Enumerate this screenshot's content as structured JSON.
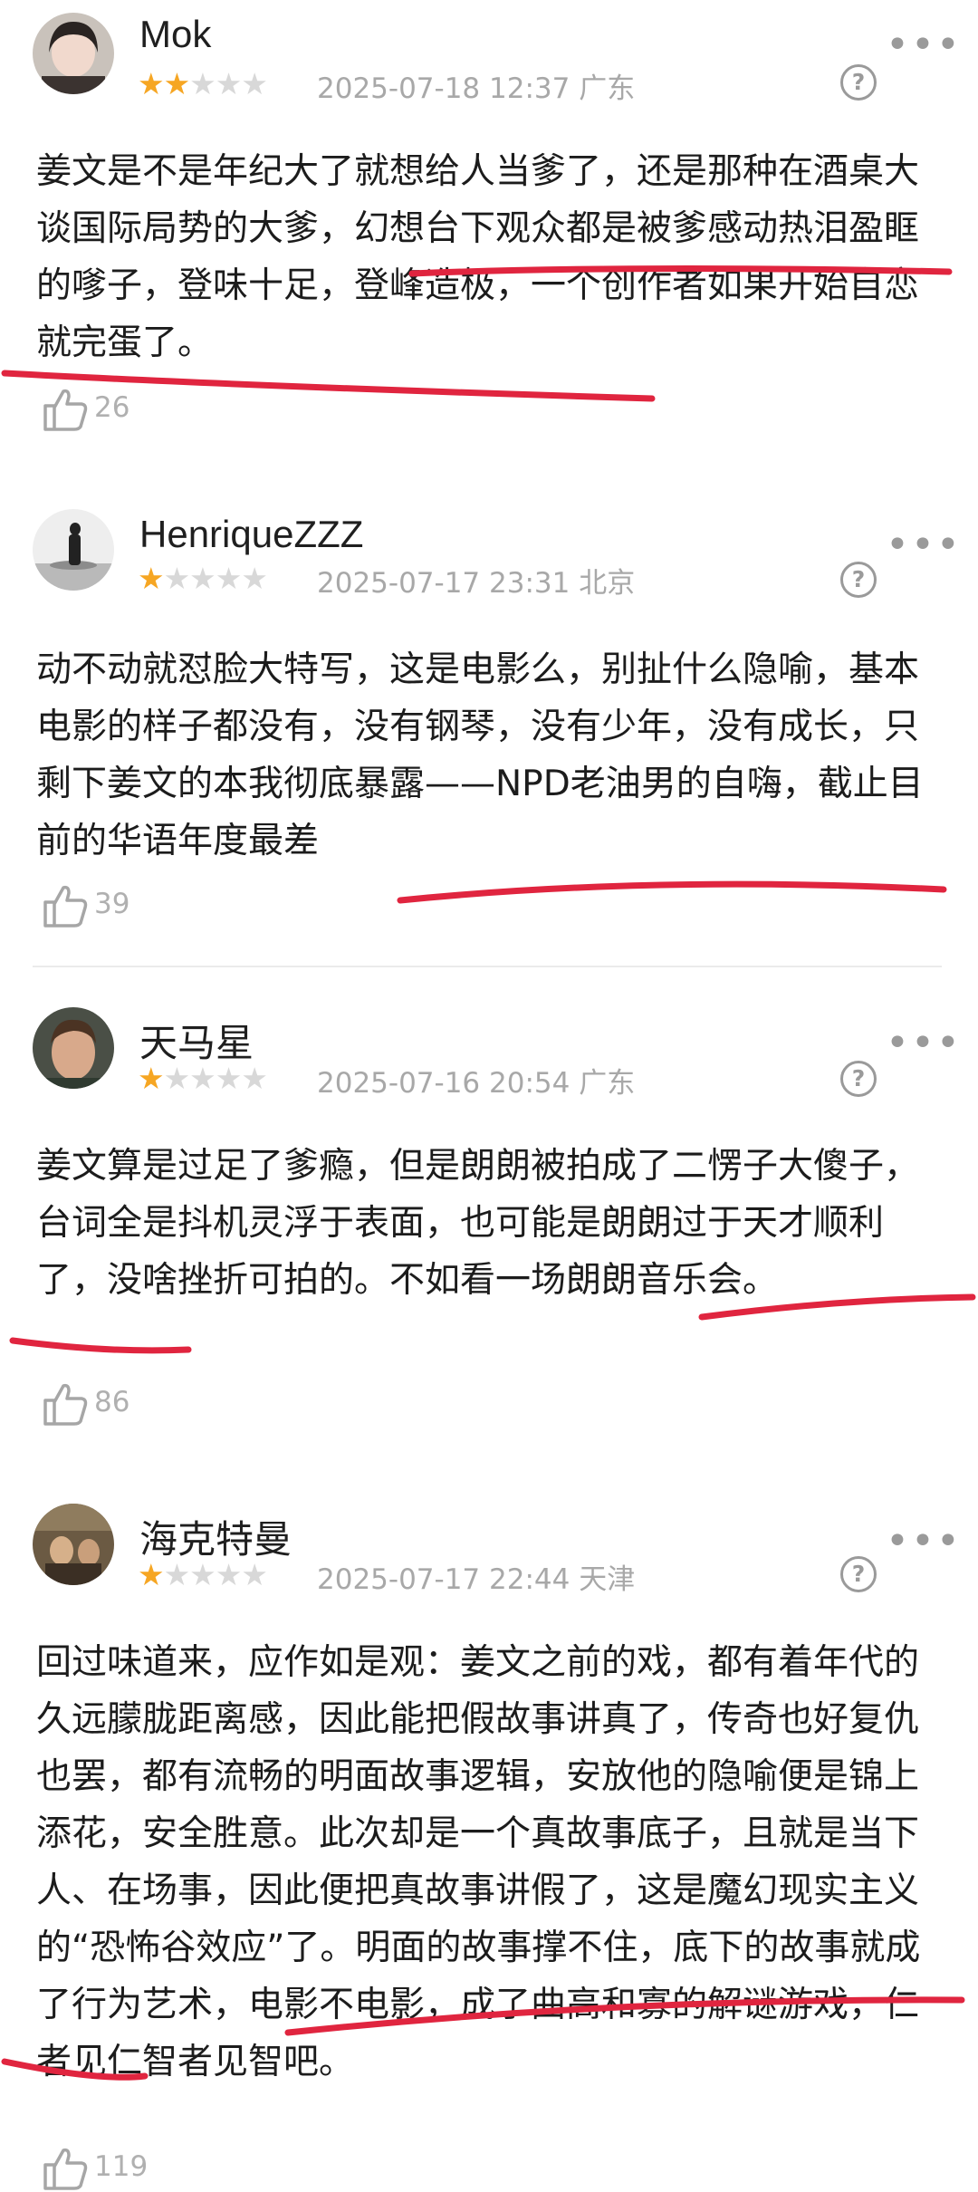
{
  "reviews": [
    {
      "username": "Mok",
      "rating": 2,
      "date": "2025-07-18 12:37",
      "location": "广东",
      "text": "姜文是不是年纪大了就想给人当爹了，还是那种在酒桌大谈国际局势的大爹，幻想台下观众都是被爹感动热泪盈眶的嗲子，登味十足，登峰造极，一个创作者如果开始自恋就完蛋了。",
      "likes": "26"
    },
    {
      "username": "HenriqueZZZ",
      "rating": 1,
      "date": "2025-07-17 23:31",
      "location": "北京",
      "text": "动不动就怼脸大特写，这是电影么，别扯什么隐喻，基本电影的样子都没有，没有钢琴，没有少年，没有成长，只剩下姜文的本我彻底暴露——NPD老油男的自嗨，截止目前的华语年度最差",
      "likes": "39"
    },
    {
      "username": "天马星",
      "rating": 1,
      "date": "2025-07-16 20:54",
      "location": "广东",
      "text": "姜文算是过足了爹瘾，但是朗朗被拍成了二愣子大傻子，台词全是抖机灵浮于表面，也可能是朗朗过于天才顺利了，没啥挫折可拍的。不如看一场朗朗音乐会。",
      "likes": "86"
    },
    {
      "username": "海克特曼",
      "rating": 1,
      "date": "2025-07-17 22:44",
      "location": "天津",
      "text": "回过味道来，应作如是观：姜文之前的戏，都有着年代的久远朦胧距离感，因此能把假故事讲真了，传奇也好复仇也罢，都有流畅的明面故事逻辑，安放他的隐喻便是锦上添花，安全胜意。此次却是一个真故事底子，且就是当下人、在场事，因此便把真故事讲假了，这是魔幻现实主义的“恐怖谷效应”了。明面的故事撑不住，底下的故事就成了行为艺术，电影不电影，成了曲高和寡的解谜游戏，仁者见仁智者见智吧。",
      "likes": "119"
    }
  ],
  "icons": {
    "help": "question-circle-icon",
    "more": "more-dots-icon",
    "like": "thumbs-up-icon"
  },
  "colors": {
    "star_on": "#f6a623",
    "star_off": "#d8d8d8",
    "underline": "#e0253f",
    "meta_text": "#a8a8a8"
  }
}
